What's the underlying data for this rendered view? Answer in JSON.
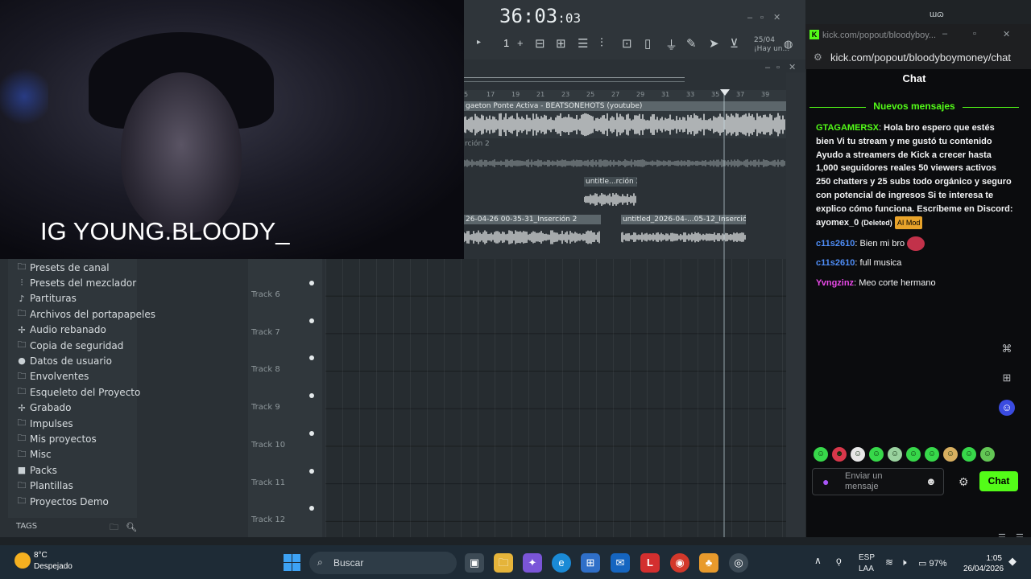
{
  "stream_overlay": {
    "text": "IG YOUNG.BLOODY_"
  },
  "browser": {
    "items": [
      {
        "icon": "folder-icon",
        "glyph": "🗀",
        "label": "Presets de canal"
      },
      {
        "icon": "sliders-icon",
        "glyph": "⫶",
        "label": "Presets del mezclador"
      },
      {
        "icon": "note-icon",
        "glyph": "♪",
        "label": "Partituras"
      },
      {
        "icon": "folder-icon",
        "glyph": "🗀",
        "label": "Archivos del portapapeles"
      },
      {
        "icon": "audio-icon",
        "glyph": "✢",
        "label": "Audio rebanado"
      },
      {
        "icon": "folder-icon",
        "glyph": "🗀",
        "label": "Copia de seguridad"
      },
      {
        "icon": "user-icon",
        "glyph": "●",
        "label": "Datos de usuario"
      },
      {
        "icon": "folder-icon",
        "glyph": "🗀",
        "label": "Envolventes"
      },
      {
        "icon": "folder-icon",
        "glyph": "🗀",
        "label": "Esqueleto del Proyecto"
      },
      {
        "icon": "audio-icon",
        "glyph": "✢",
        "label": "Grabado"
      },
      {
        "icon": "folder-icon",
        "glyph": "🗀",
        "label": "Impulses"
      },
      {
        "icon": "folder-icon",
        "glyph": "🗀",
        "label": "Mis proyectos"
      },
      {
        "icon": "folder-icon",
        "glyph": "🗀",
        "label": "Misc"
      },
      {
        "icon": "box-icon",
        "glyph": "■",
        "label": "Packs"
      },
      {
        "icon": "folder-icon",
        "glyph": "🗀",
        "label": "Plantillas"
      },
      {
        "icon": "folder-icon",
        "glyph": "🗀",
        "label": "Proyectos Demo"
      }
    ],
    "tags_label": "TAGS"
  },
  "transport": {
    "time_main": "36:03",
    "time_sub": "03",
    "pattern_number": "1",
    "date": "25/04",
    "notice": "¡Hay un..."
  },
  "playlist": {
    "ruler": [
      "5",
      "17",
      "19",
      "21",
      "23",
      "25",
      "27",
      "29",
      "31",
      "33",
      "35",
      "37",
      "39"
    ],
    "clips": {
      "main": "gaeton Ponte Activa - BEATSONEHOTS (youtube)",
      "lane2": "rción 2",
      "small": "untitle...rción 2",
      "left": "26-04-26 00-35-31_Inserción 2",
      "right": "untitled_2026-04-...05-12_Inserción 2"
    },
    "tracks": [
      "Track 6",
      "Track 7",
      "Track 8",
      "Track 9",
      "Track 10",
      "Track 11",
      "Track 12"
    ]
  },
  "chat": {
    "window_title": "kick.com/popout/bloodyboy...",
    "url": "kick.com/popout/bloodyboymoney/chat",
    "heading": "Chat",
    "new_messages": "Nuevos mensajes",
    "messages": [
      {
        "user": "GTAGAMERSX",
        "color": "#53fc18",
        "text": "Hola bro espero que estés bien Vi tu stream y me gustó tu contenido Ayudo a streamers de Kick a crecer hasta 1,000 seguidores reales 50 viewers activos 250 chatters y 25 subs todo orgánico y seguro con potencial de ingresos Si te interesa te explico cómo funciona. Escríbeme en Discord: ayomex_0",
        "deleted": "(Deleted)",
        "badge": "AI Mod"
      },
      {
        "user": "c11s2610",
        "color": "#4f8ef7",
        "text": "Bien mi bro"
      },
      {
        "user": "c11s2610",
        "color": "#4f8ef7",
        "text": "full musica"
      },
      {
        "user": "Yvngzinz",
        "color": "#e94ae8",
        "text": "Meo corte hermano"
      }
    ],
    "input_placeholder": "Enviar un mensaje",
    "send_label": "Chat"
  },
  "taskbar": {
    "weather_temp": "8°C",
    "weather_desc": "Despejado",
    "search_label": "Buscar",
    "lang1": "ESP",
    "lang2": "LAA",
    "battery": "97%",
    "time": "1:05",
    "date": "26/04/2026"
  }
}
